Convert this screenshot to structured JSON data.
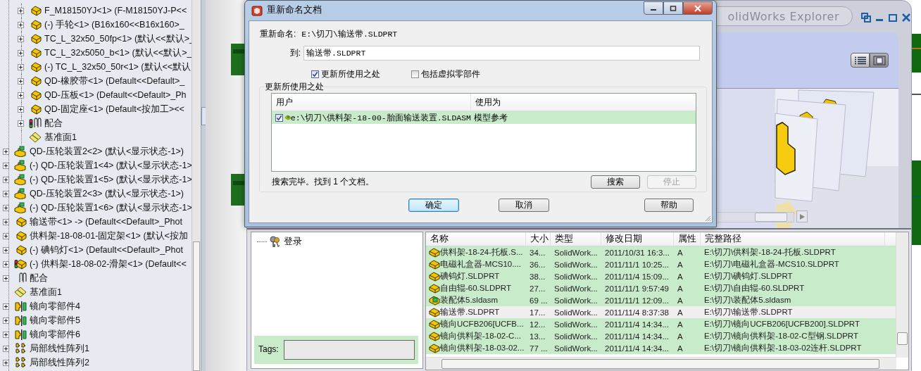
{
  "feature_tree": {
    "continued_children": [
      {
        "label": "F_M18150YJ<1> (F-M18150YJ-P<<",
        "kind": "part",
        "expandable": true
      },
      {
        "label": "(-) 手轮<1> (B16x160<<B16x160>_",
        "kind": "part",
        "expandable": true
      },
      {
        "label": "TC_L_32x50_50fp<1> (默认<<默认>_",
        "kind": "part",
        "expandable": true
      },
      {
        "label": "TC_L_32x5050_b<1> (默认<<默认>_",
        "kind": "part",
        "expandable": true
      },
      {
        "label": "(-) TC_L_32x50_50r<1> (默认<<默认",
        "kind": "part",
        "expandable": true
      },
      {
        "label": "QD-橡胶带<1> (Default<<Default>_",
        "kind": "part",
        "expandable": true
      },
      {
        "label": "QD-压板<1> (Default<<Default>_Ph",
        "kind": "part",
        "expandable": true
      },
      {
        "label": "QD-固定座<1> (Default<按加工><<",
        "kind": "part",
        "expandable": true
      },
      {
        "label": "配合",
        "kind": "mates_status",
        "expandable": true
      },
      {
        "label": "基准面1",
        "kind": "plane",
        "expandable": false
      }
    ],
    "items": [
      {
        "label": "QD-压轮装置2<2> (默认<显示状态-1>)",
        "kind": "assembly",
        "expandable": true
      },
      {
        "label": "(-) QD-压轮装置1<4> (默认<显示状态-1>",
        "kind": "assembly",
        "expandable": true
      },
      {
        "label": "(-) QD-压轮装置1<5> (默认<显示状态-1>",
        "kind": "assembly",
        "expandable": true
      },
      {
        "label": "QD-压轮装置2<3> (默认<显示状态-1>)",
        "kind": "assembly",
        "expandable": true
      },
      {
        "label": "(-) QD-压轮装置1<6> (默认<显示状态-1>",
        "kind": "assembly",
        "expandable": true
      },
      {
        "label": "输送带<1> -> (Default<<Default>_Phot",
        "kind": "part",
        "expandable": true
      },
      {
        "label": "供料架-18-08-01-固定架<1> (默认<按加",
        "kind": "part",
        "expandable": true
      },
      {
        "label": "(-) 碘钨灯<1> (Default<<Default>_Phot",
        "kind": "part",
        "expandable": true
      },
      {
        "label": "(-) 供料架-18-08-02-滑架<1> (Default<<",
        "kind": "part_status",
        "expandable": true
      },
      {
        "label": "配合",
        "kind": "mates",
        "expandable": true
      },
      {
        "label": "基准面1",
        "kind": "plane",
        "expandable": false
      },
      {
        "label": "镜向零部件4",
        "kind": "mirror",
        "expandable": true
      },
      {
        "label": "镜向零部件5",
        "kind": "mirror",
        "expandable": true
      },
      {
        "label": "镜向零部件6",
        "kind": "mirror",
        "expandable": true
      },
      {
        "label": "局部线性阵列1",
        "kind": "pattern",
        "expandable": true
      },
      {
        "label": "局部线性阵列2",
        "kind": "pattern",
        "expandable": true
      }
    ]
  },
  "explorer": {
    "title": "olidWorks Explorer",
    "tree_items": [
      {
        "label": "登录",
        "kind": "keys"
      }
    ],
    "tags": {
      "label": "Tags:"
    },
    "file_list": {
      "columns": [
        "名称",
        "大小",
        "类型",
        "修改日期",
        "属性",
        "完整路径"
      ],
      "rows": [
        {
          "kind": "part",
          "selected": false,
          "cells": [
            "供料架-18-24-托板.S...",
            "34...",
            "SolidWork...",
            "2011/10/31 16:3...",
            "A",
            "E:\\切刀\\供料架-18-24-托板.SLDPRT"
          ]
        },
        {
          "kind": "part",
          "selected": false,
          "cells": [
            "电磁礼盒器-MCS10....",
            "36...",
            "SolidWork...",
            "2011/11/1 10:25...",
            "A",
            "E:\\切刀\\电磁礼盒器-MCS10.SLDPRT"
          ]
        },
        {
          "kind": "part",
          "selected": false,
          "cells": [
            "碘钨灯.SLDPRT",
            "38...",
            "SolidWork...",
            "2011/11/4 15:09...",
            "A",
            "E:\\切刀\\碘钨灯.SLDPRT"
          ]
        },
        {
          "kind": "part",
          "selected": false,
          "cells": [
            "自由辊-60.SLDPRT",
            "27...",
            "SolidWork...",
            "2011/11/1 9:57:49",
            "A",
            "E:\\切刀\\自由辊-60.SLDPRT"
          ]
        },
        {
          "kind": "assembly",
          "selected": false,
          "cells": [
            "装配体5.sldasm",
            "69 ...",
            "SolidWork...",
            "2011/11/1 12:09...",
            "A",
            "E:\\切刀\\装配体5.sldasm"
          ]
        },
        {
          "kind": "part",
          "selected": true,
          "cells": [
            "输送带.SLDPRT",
            "17...",
            "SolidWork...",
            "2011/11/4 8:37:38",
            "A",
            "E:\\切刀\\输送带.SLDPRT"
          ]
        },
        {
          "kind": "part",
          "selected": false,
          "cells": [
            "镜向UCFB206[UCFB...",
            "12...",
            "SolidWork...",
            "2011/11/4 14:34...",
            "A",
            "E:\\切刀\\镜向UCFB206[UCFB200].SLDPRT"
          ]
        },
        {
          "kind": "part",
          "selected": false,
          "cells": [
            "镜向供料架-18-02-C...",
            "13...",
            "SolidWork...",
            "2011/11/4 14:34...",
            "A",
            "E:\\切刀\\镜向供料架-18-02-C型钢.SLDPRT"
          ]
        },
        {
          "kind": "part",
          "selected": false,
          "cells": [
            "镜向供料架-18-03-02...",
            "77 ...",
            "SolidWork...",
            "2011/11/4 14:34...",
            "A",
            "E:\\切刀\\镜向供料架-18-03-02连杆.SLDPRT"
          ]
        }
      ]
    }
  },
  "dialog": {
    "title": "重新命名文档",
    "rename_label": "重新命名:",
    "rename_value": "E:\\切刀\\输送带.SLDPRT",
    "to_label": "到:",
    "to_value": "输送带.SLDPRT",
    "options": [
      {
        "label": "更新所使用之处",
        "checked": true
      },
      {
        "label": "包括虚拟零部件",
        "checked": false
      }
    ],
    "group_title": "更新所使用之处",
    "references": {
      "columns": [
        "用户",
        "使用为"
      ],
      "rows": [
        {
          "checked": true,
          "user": "e:\\切刀\\供料架-18-00-胎面输送装置.SLDASM",
          "used_as": "模型参考"
        }
      ]
    },
    "status": "搜索完毕。找到 1 个文档。",
    "search_buttons": [
      {
        "label": "搜索",
        "disabled": false
      },
      {
        "label": "停止",
        "disabled": true
      }
    ],
    "buttons": [
      {
        "label": "确定",
        "default": true
      },
      {
        "label": "取消",
        "default": false
      },
      {
        "label": "帮助",
        "default": false
      }
    ]
  }
}
